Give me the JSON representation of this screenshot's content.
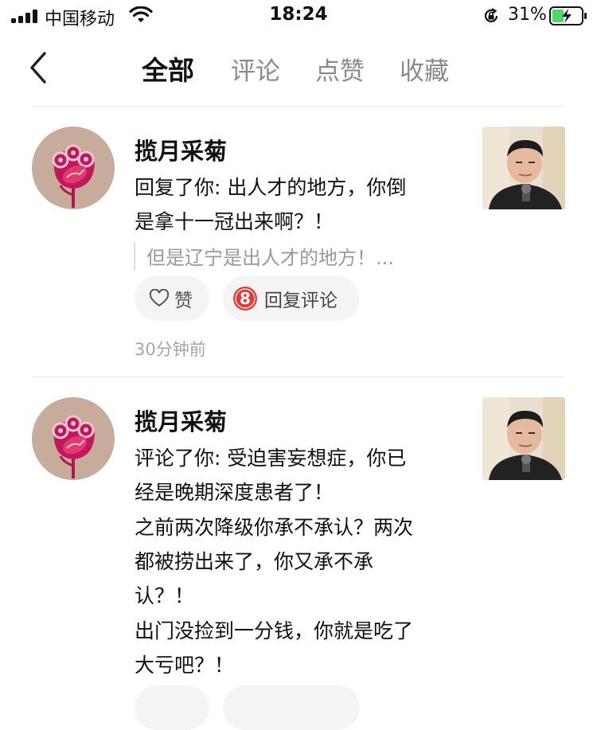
{
  "status_bar": {
    "carrier": "中国移动",
    "time": "18:24",
    "battery_percent": "31%",
    "icons": [
      "signal-icon",
      "wifi-icon",
      "rotation-lock-icon",
      "battery-charging-icon"
    ]
  },
  "header": {
    "back_icon": "chevron-left-icon",
    "tabs": [
      {
        "label": "全部",
        "active": true
      },
      {
        "label": "评论",
        "active": false
      },
      {
        "label": "点赞",
        "active": false
      },
      {
        "label": "收藏",
        "active": false
      }
    ]
  },
  "notifications": [
    {
      "username": "揽月采菊",
      "lines": [
        "回复了你: 出人才的地方，你倒",
        "是拿十一冠出来啊？！"
      ],
      "quote": "但是辽宁是出人才的地方！...",
      "like_label": "赞",
      "reply_badge": "8",
      "reply_label": "回复评论",
      "time": "30分钟前"
    },
    {
      "username": "揽月采菊",
      "lines": [
        "评论了你: 受迫害妄想症，你已",
        "经是晚期深度患者了！",
        "之前两次降级你承不承认？两次",
        "都被捞出来了，你又承不承",
        "认？！",
        "出门没捡到一分钱，你就是吃了",
        "大亏吧？！"
      ]
    }
  ],
  "colors": {
    "avatar_bg": "#c7ab9b",
    "flower": "#c2185b",
    "badge": "#e53935",
    "muted_text": "#9a9a9a"
  }
}
